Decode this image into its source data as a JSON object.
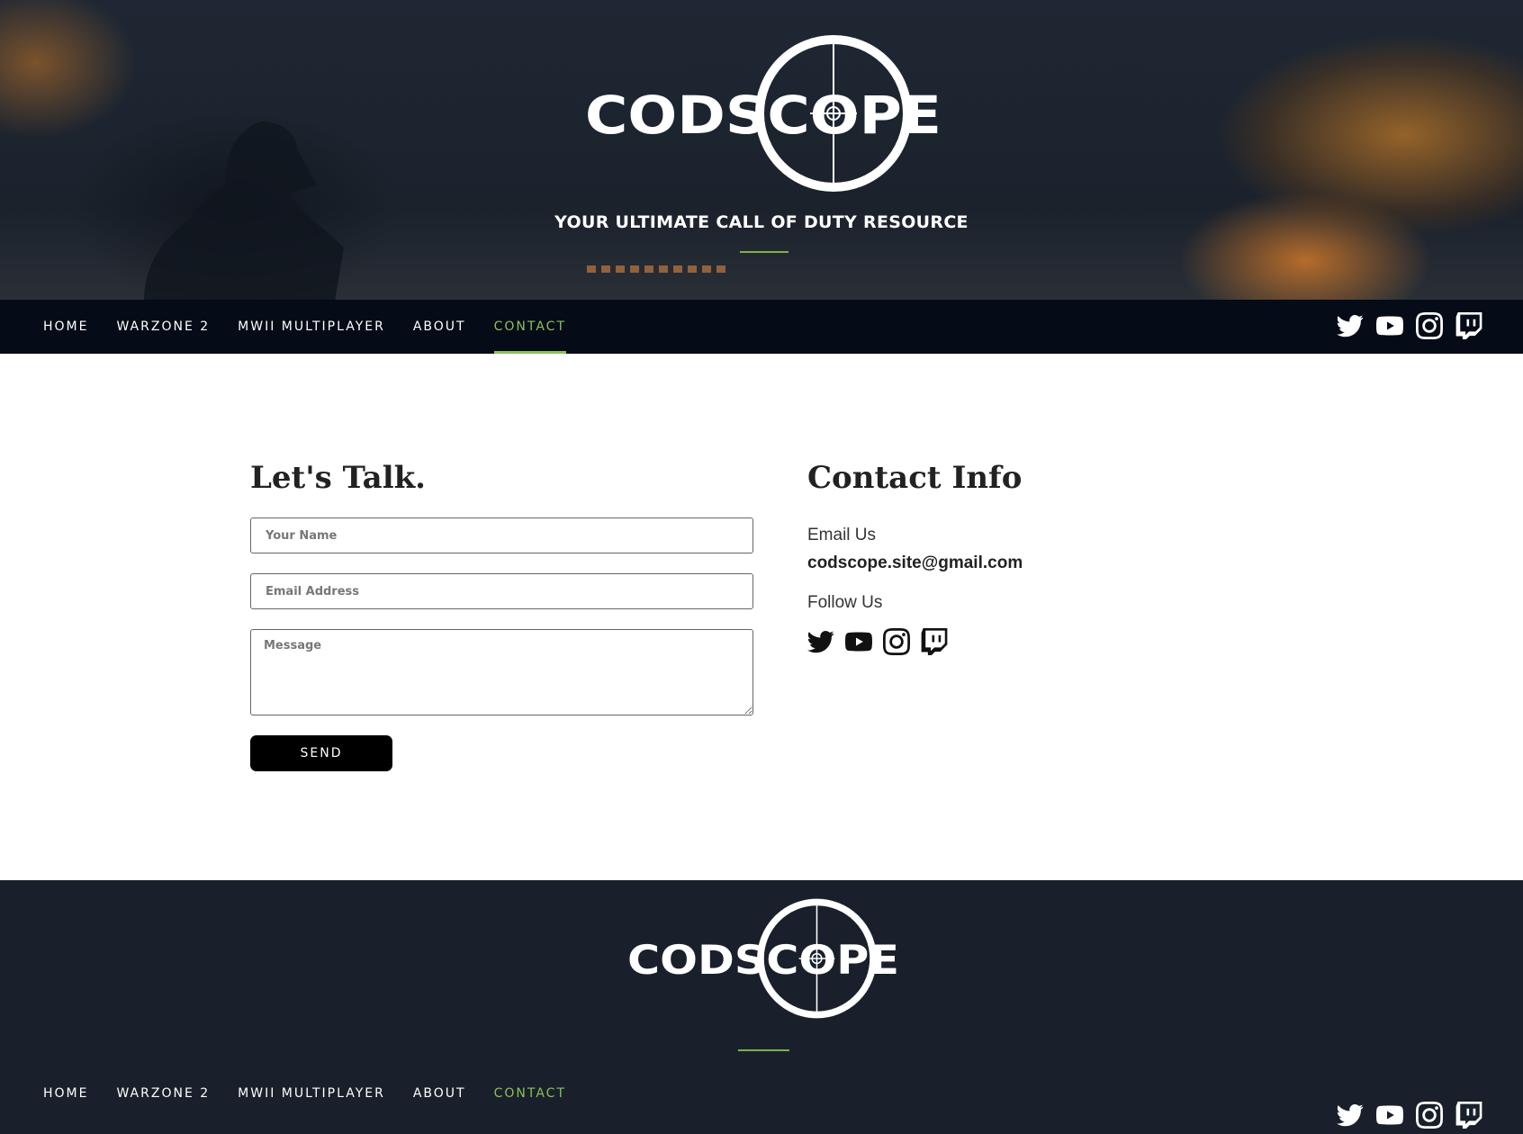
{
  "hero": {
    "logo_text": "CODSCOPE",
    "tagline": "YOUR ULTIMATE CALL OF DUTY RESOURCE"
  },
  "nav": {
    "items": [
      {
        "label": "HOME",
        "active": false
      },
      {
        "label": "WARZONE 2",
        "active": false
      },
      {
        "label": "MWII MULTIPLAYER",
        "active": false
      },
      {
        "label": "ABOUT",
        "active": false
      },
      {
        "label": "CONTACT",
        "active": true
      }
    ],
    "socials": [
      "twitter-icon",
      "youtube-icon",
      "instagram-icon",
      "twitch-icon"
    ]
  },
  "contact_form": {
    "title": "Let's Talk.",
    "name_placeholder": "Your Name",
    "email_placeholder": "Email Address",
    "message_placeholder": "Message",
    "send_label": "SEND"
  },
  "contact_info": {
    "title": "Contact Info",
    "email_label": "Email Us",
    "email_value": "codscope.site@gmail.com",
    "follow_label": "Follow Us"
  },
  "footer": {
    "logo_text": "CODSCOPE"
  },
  "colors": {
    "accent": "#8cc05a",
    "nav_bg": "#050b17",
    "footer_bg": "#19202b",
    "button_bg": "#000000"
  }
}
